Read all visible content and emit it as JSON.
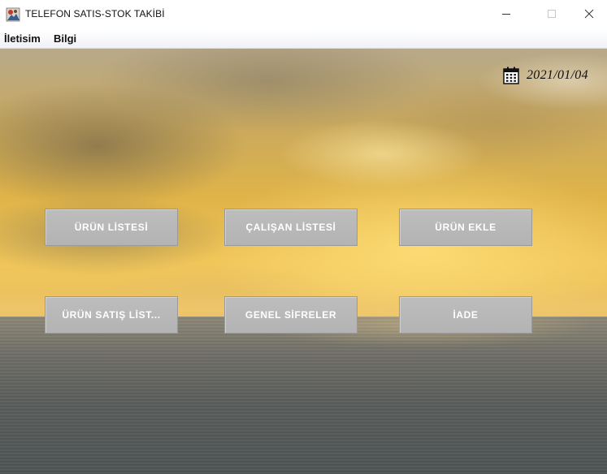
{
  "window": {
    "title": "TELEFON SATIS-STOK TAKİBİ"
  },
  "menubar": {
    "items": [
      {
        "label": "İletisim"
      },
      {
        "label": "Bilgi"
      }
    ]
  },
  "header": {
    "date": "2021/01/04",
    "date_icon": "calendar-icon"
  },
  "buttons": {
    "urun_listesi": "ÜRÜN LİSTESİ",
    "calisan_listesi": "ÇALIŞAN LİSTESİ",
    "urun_ekle": "ÜRÜN EKLE",
    "urun_satis_listesi": "ÜRÜN SATIŞ LİST...",
    "genel_sifreler": "GENEL SİFRELER",
    "iade": "İADE"
  },
  "colors": {
    "button_bg": "#b8b8b8",
    "button_text": "#ffffff"
  }
}
